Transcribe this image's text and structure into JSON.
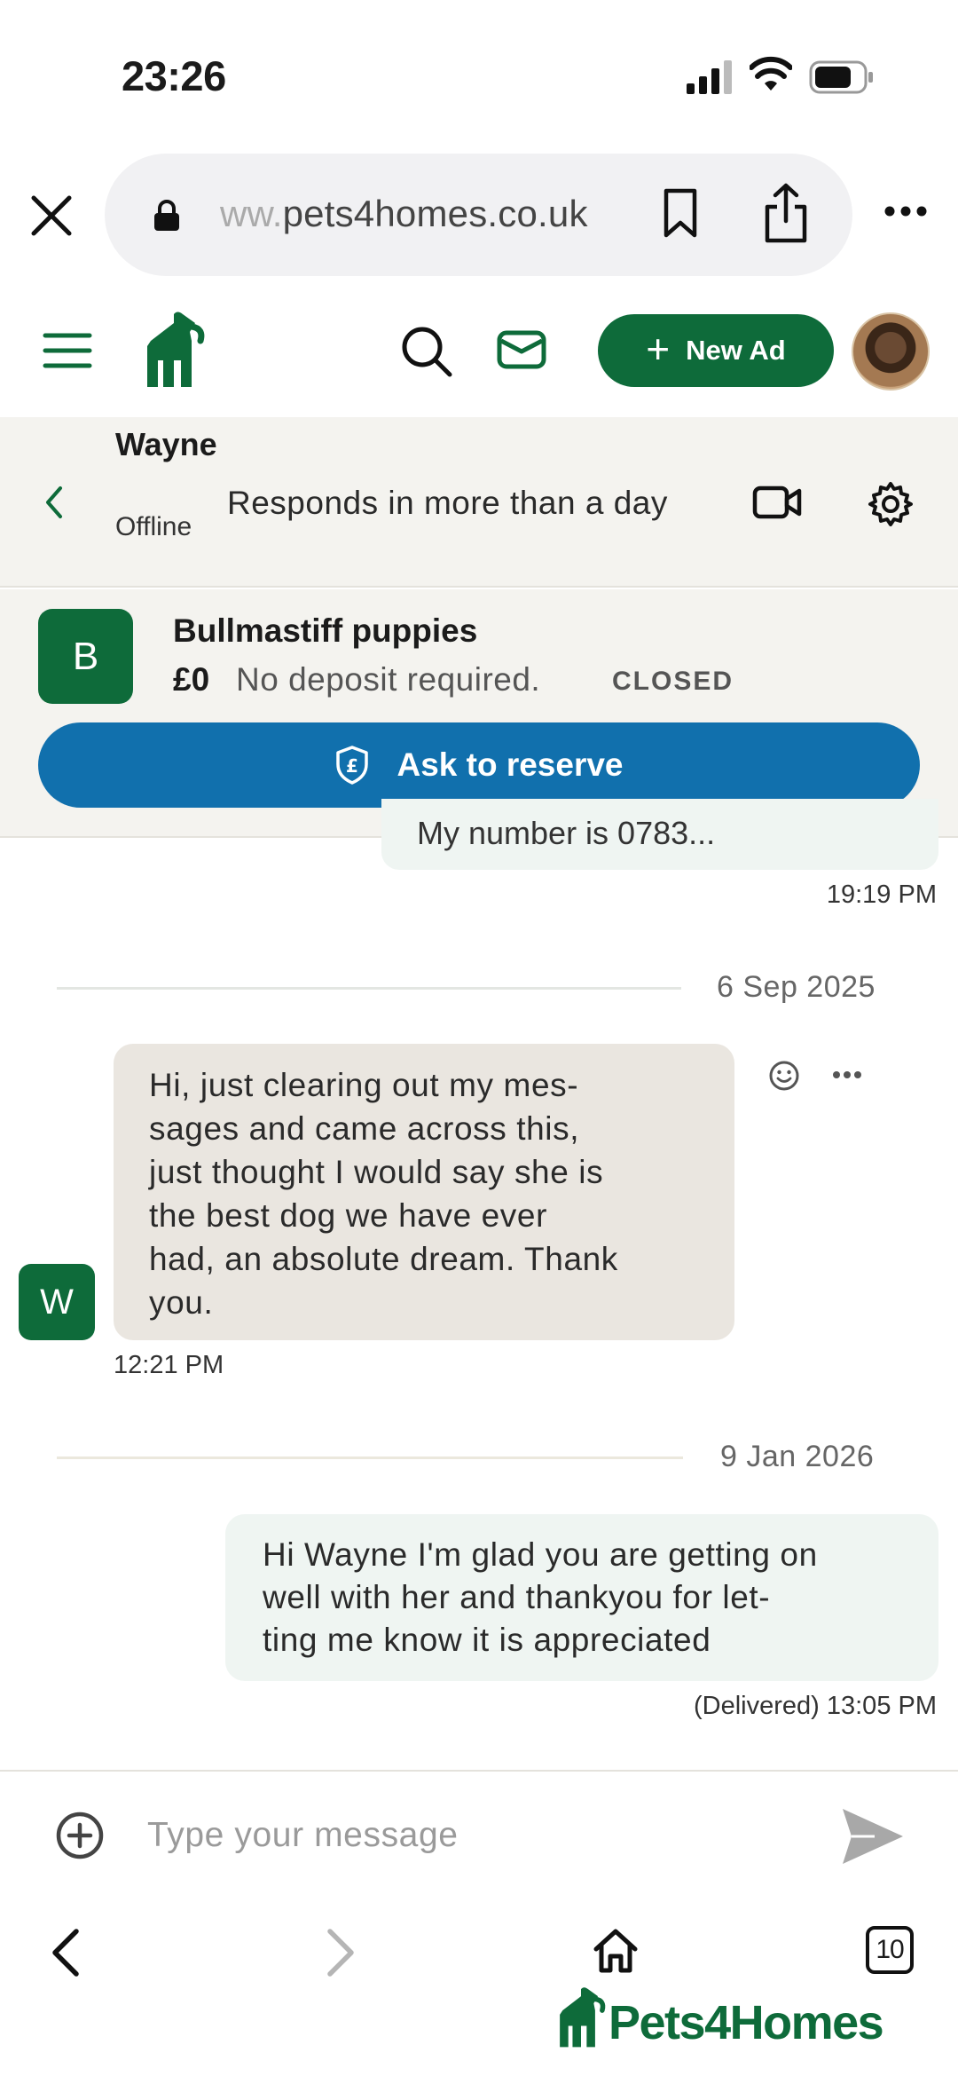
{
  "status_bar": {
    "time": "23:26"
  },
  "browser": {
    "url_prefix": "ww.",
    "url_domain": "pets4homes.co.uk",
    "icons": [
      "close-icon",
      "lock-icon",
      "bookmark-icon",
      "share-icon",
      "more-icon"
    ]
  },
  "app_header": {
    "new_ad_label": "New Ad",
    "brand_color": "#0e6b3a"
  },
  "chat_header": {
    "contact_name": "Wayne",
    "status": "Offline",
    "response_time": "Responds in more than a day"
  },
  "listing": {
    "avatar_letter": "B",
    "title": "Bullmastiff puppies",
    "price": "£0",
    "deposit": "No deposit required.",
    "state": "CLOSED",
    "reserve_label": "Ask to reserve",
    "reserve_color": "#1170ad"
  },
  "messages": [
    {
      "direction": "outgoing",
      "text": "My number is 0783...",
      "time": "19:19 PM"
    },
    {
      "date_separator": "6 Sep 2025"
    },
    {
      "direction": "incoming",
      "sender_initial": "W",
      "lines": [
        "Hi, just clearing out my mes-",
        "sages and came across this,",
        "just thought I would say she is",
        "the best dog we have ever",
        "had, an absolute dream. Thank",
        "you."
      ],
      "time": "12:21 PM"
    },
    {
      "date_separator": "9 Jan 2026"
    },
    {
      "direction": "outgoing",
      "lines": [
        "Hi Wayne I'm glad you are getting on",
        "well with her and thankyou for let-",
        "ting me know it is appreciated"
      ],
      "time": "(Delivered) 13:05 PM"
    }
  ],
  "composer": {
    "placeholder": "Type your message"
  },
  "bottom_nav": {
    "tab_count": "10",
    "brand_name": "Pets4Homes"
  }
}
